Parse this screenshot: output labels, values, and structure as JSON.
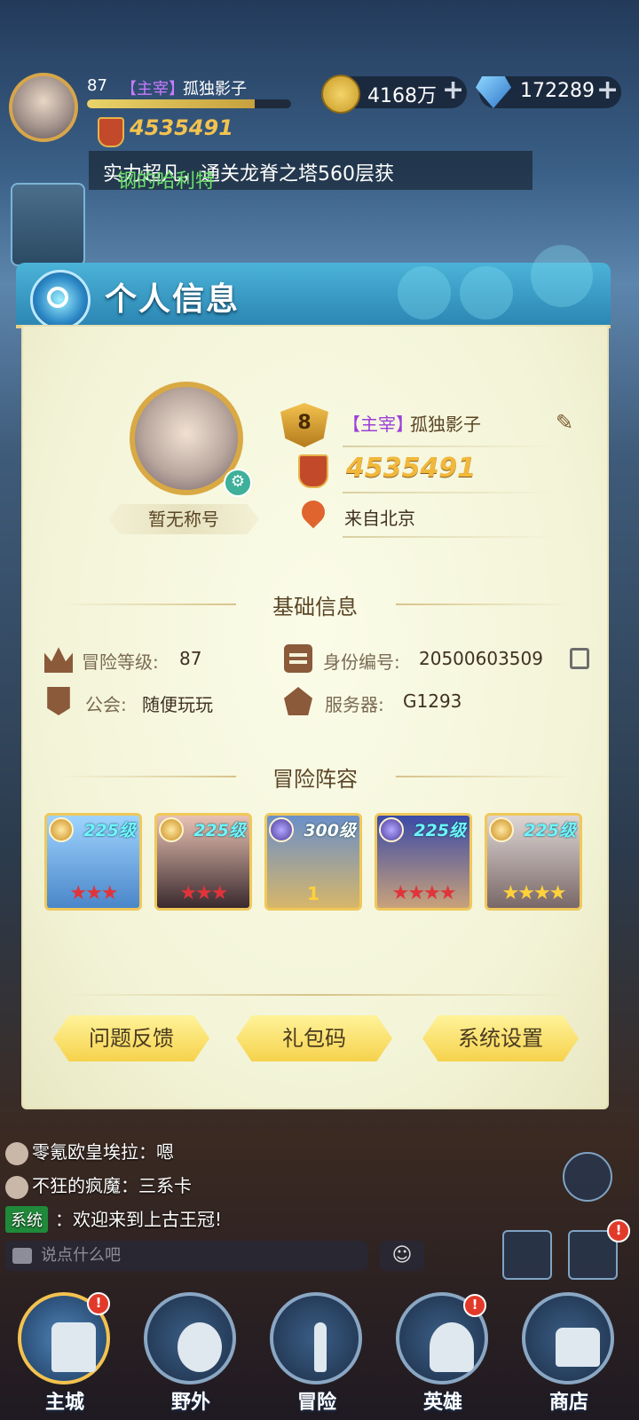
{
  "hud": {
    "level": "87",
    "title_tag": "【主宰】",
    "player_name": "孤独影子",
    "xp_fraction": 0.82,
    "power": "4535491",
    "gold": "4168万",
    "diamonds": "172289",
    "ticker_highlight": "钢的哈利特",
    "ticker_text": "实力超凡，通关龙脊之塔560层获"
  },
  "panel": {
    "title": "个人信息",
    "badge": "暂无称号",
    "vip_level": "8",
    "title_tag": "【主宰】",
    "name": "孤独影子",
    "power": "4535491",
    "location": "来自北京",
    "basic_info_title": "基础信息",
    "adventure_level_label": "冒险等级:",
    "adventure_level": "87",
    "id_label": "身份编号:",
    "id_value": "20500603509",
    "guild_label": "公会:",
    "guild_value": "随便玩玩",
    "server_label": "服务器:",
    "server_value": "G1293",
    "lineup_title": "冒险阵容",
    "heroes": [
      {
        "level": "225级",
        "stars": "★★★",
        "star_color": "red",
        "element": "light"
      },
      {
        "level": "225级",
        "stars": "★★★",
        "star_color": "red",
        "element": "light"
      },
      {
        "level": "300级",
        "stars": "1",
        "star_color": "wings",
        "element": "void"
      },
      {
        "level": "225级",
        "stars": "★★★★",
        "star_color": "red",
        "element": "void"
      },
      {
        "level": "225级",
        "stars": "★★★★",
        "star_color": "gold",
        "element": "light"
      }
    ],
    "buttons": [
      "问题反馈",
      "礼包码",
      "系统设置"
    ]
  },
  "chat": {
    "lines": [
      {
        "speaker": "零氪欧皇埃拉",
        "text": "：嗯"
      },
      {
        "speaker": "不狂的疯魔",
        "text": "：三系卡"
      }
    ],
    "system_tag": "系统",
    "system_text": "：欢迎来到上古王冠!",
    "input_placeholder": "说点什么吧"
  },
  "nav": [
    {
      "label": "主城",
      "alert": "!"
    },
    {
      "label": "野外",
      "alert": ""
    },
    {
      "label": "冒险",
      "alert": ""
    },
    {
      "label": "英雄",
      "alert": "!"
    },
    {
      "label": "商店",
      "alert": ""
    }
  ],
  "colors": {
    "accent_gold": "#f3c24f",
    "header_blue": "#2c86b3",
    "panel_bg": "#f2f3d6",
    "title_purple": "#9b3fd8"
  }
}
